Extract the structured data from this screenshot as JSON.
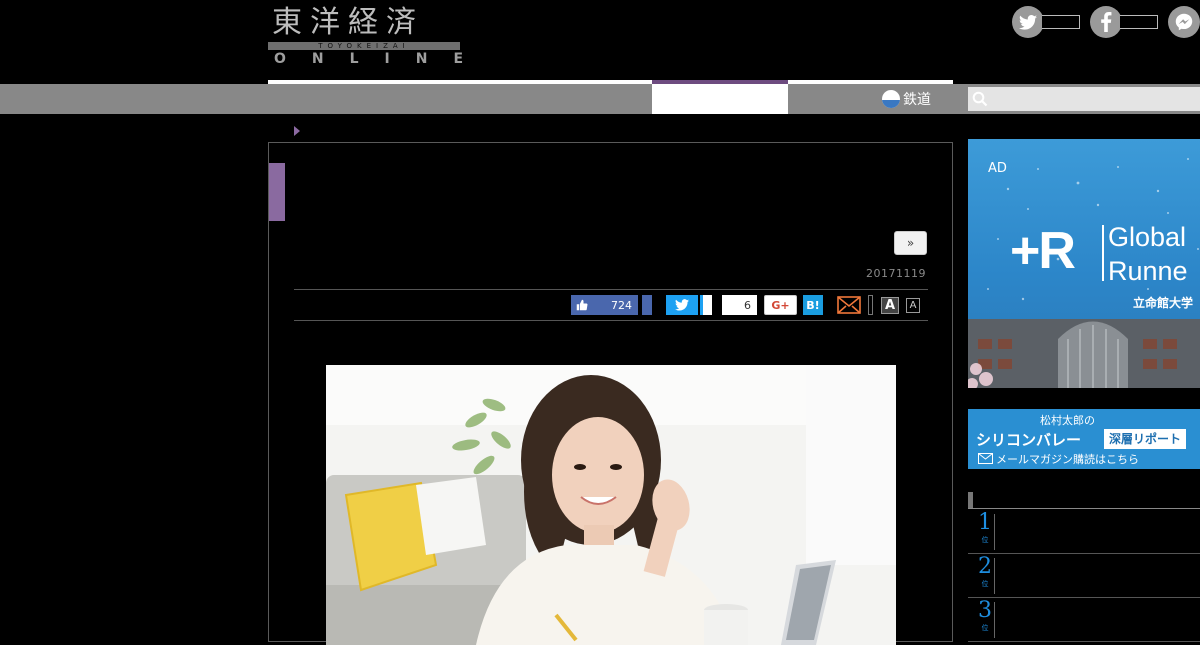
{
  "header": {
    "logo_kanji": "東洋経済",
    "logo_romaji": "TOYOKEIZAI",
    "logo_online": "ONLINE",
    "social": [
      "twitter-icon",
      "facebook-icon",
      "messenger-icon"
    ]
  },
  "nav": {
    "rail_label": "鉄道",
    "search_placeholder": ""
  },
  "article": {
    "next_button": "»",
    "date": "20171119",
    "share": {
      "like_count": "724",
      "hatena_count": "6",
      "gplus_label": "G+",
      "hatena_label": "B!",
      "font_large": "A",
      "font_small": "A"
    }
  },
  "sidebar": {
    "ad": {
      "label": "AD",
      "plus_r": "+R",
      "line1": "Global",
      "line2": "Runne",
      "school": "立命館大学"
    },
    "newsletter": {
      "author": "松村太郎の",
      "title": "シリコンバレー",
      "tag": "深層リポート",
      "sub": "メールマガジン購読はこちら"
    },
    "ranking": [
      {
        "rank": "1",
        "suffix": "位"
      },
      {
        "rank": "2",
        "suffix": "位"
      },
      {
        "rank": "3",
        "suffix": "位"
      }
    ]
  },
  "colors": {
    "accent_purple": "#8a6aa0",
    "nav_gray": "#888888",
    "twitter_blue": "#1da1f2",
    "facebook_blue": "#4a67ad",
    "hatena_blue": "#1a9de0",
    "rank_blue": "#1e8ee0"
  }
}
